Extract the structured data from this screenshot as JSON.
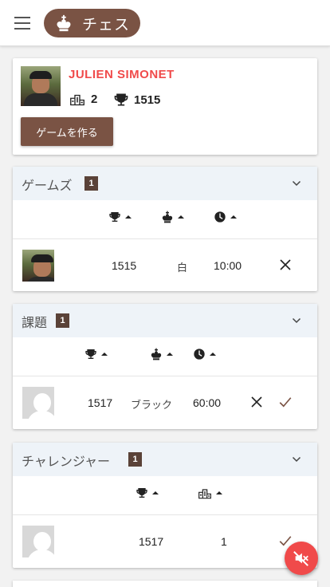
{
  "app": {
    "title": "チェス"
  },
  "profile": {
    "name": "JULIEN SIMONET",
    "rank": "2",
    "rating": "1515",
    "create_label": "ゲームを作る"
  },
  "games": {
    "title": "ゲームズ",
    "badge": "1",
    "rows": [
      {
        "rating": "1515",
        "color": "白",
        "time": "10:00"
      }
    ]
  },
  "problems": {
    "title": "課題",
    "badge": "1",
    "rows": [
      {
        "rating": "1517",
        "color": "ブラック",
        "time": "60:00"
      }
    ]
  },
  "challengers": {
    "title": "チャレンジャー",
    "badge": "1",
    "rows": [
      {
        "rating": "1517",
        "rank": "1"
      }
    ]
  },
  "colors": {
    "brand": "#7a5344",
    "accent": "#f04a4a",
    "section_header": "#eef3f8"
  },
  "icons": [
    "menu-icon",
    "chess-king-icon",
    "podium-icon",
    "trophy-icon",
    "clock-icon",
    "chevron-down-icon",
    "close-icon",
    "check-icon",
    "mute-icon"
  ]
}
